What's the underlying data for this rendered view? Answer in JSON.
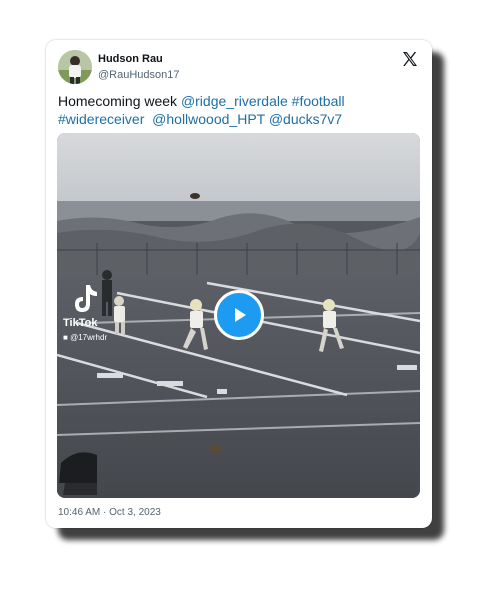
{
  "author": {
    "name": "Hudson Rau",
    "handle": "@RauHudson17"
  },
  "tweet": {
    "text_plain": "Homecoming week ",
    "links": [
      "@ridge_riverdale",
      "#football",
      "#widereceiver",
      "@hollwoood_HPT",
      "@ducks7v7"
    ]
  },
  "media": {
    "watermark_brand": "TikTok",
    "watermark_user": "@17wrhdr"
  },
  "timestamp": "10:46 AM · Oct 3, 2023",
  "icons": [
    "x-logo-icon",
    "play-icon",
    "tiktok-logo-icon",
    "user-icon"
  ],
  "colors": {
    "link": "#1d6fa5",
    "play_button": "#1d9bf0",
    "text": "#0f1419",
    "muted": "#536471"
  }
}
